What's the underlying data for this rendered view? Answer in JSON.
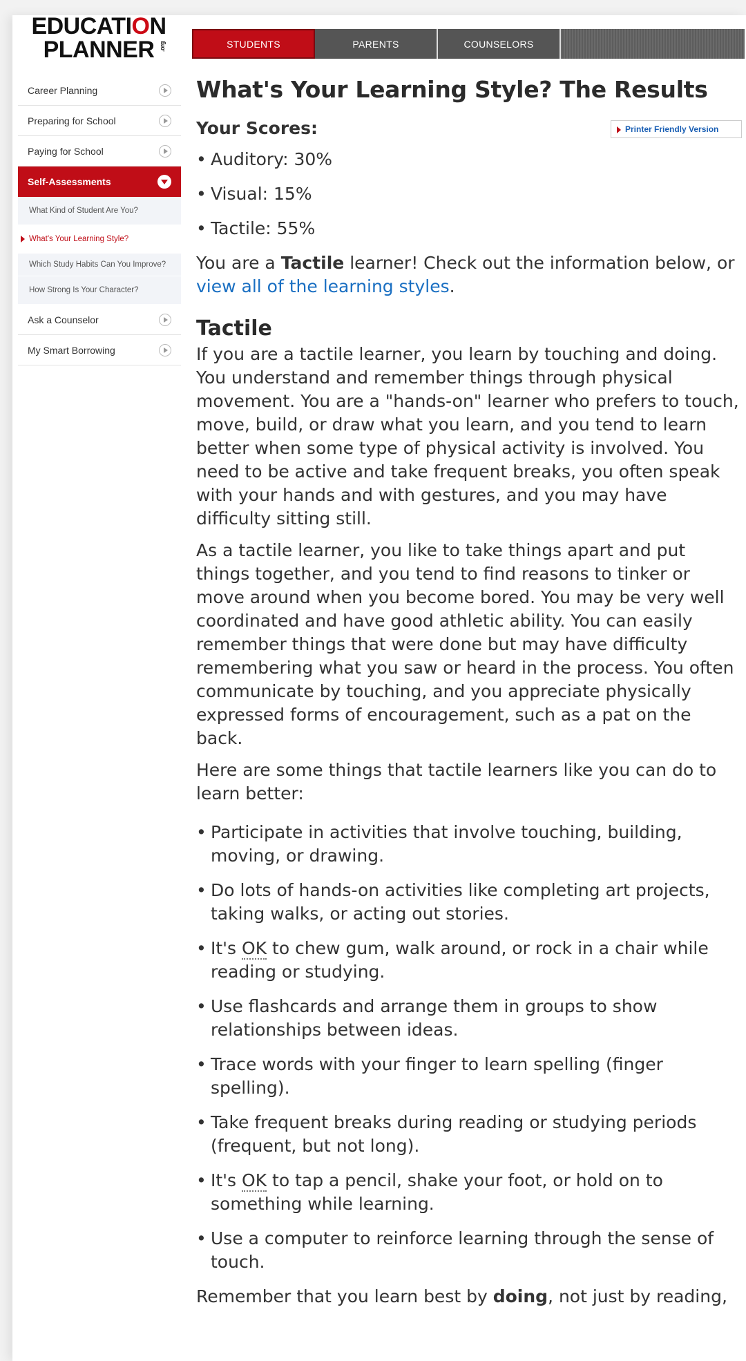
{
  "logo": {
    "line1_a": "EDUCATI",
    "line1_o": "O",
    "line1_b": "N",
    "line2": "PLANNER",
    "org": ".org"
  },
  "nav": {
    "tabs": [
      "STUDENTS",
      "PARENTS",
      "COUNSELORS"
    ]
  },
  "sidebar": {
    "items": [
      "Career Planning",
      "Preparing for School",
      "Paying for School"
    ],
    "active": "Self-Assessments",
    "sub_items": [
      "What Kind of Student Are You?",
      "What's Your Learning Style?",
      "Which Study Habits Can You Improve?",
      "How Strong Is Your Character?"
    ],
    "more_items": [
      "Ask a Counselor",
      "My Smart Borrowing"
    ]
  },
  "main": {
    "title": "What's Your Learning Style? The Results",
    "scores_heading": "Your Scores:",
    "printer_label": "Printer Friendly Version",
    "scores": [
      "Auditory: 30%",
      "Visual: 15%",
      "Tactile: 55%"
    ],
    "result": {
      "pre": "You are a ",
      "style": "Tactile",
      "mid": " learner! Check out the information below, or ",
      "link": "view all of the learning styles",
      "post": "."
    },
    "section_heading": "Tactile",
    "para1": "If you are a tactile learner, you learn by touching and doing. You understand and remember things through physical movement. You are a \"hands-on\" learner who prefers to touch, move, build, or draw what you learn, and you tend to learn better when some type of physical activity is involved. You need to be active and take frequent breaks, you often speak with your hands and with gestures, and you may have difficulty sitting still.",
    "para2": "As a tactile learner, you like to take things apart and put things together, and you tend to find reasons to tinker or move around when you become bored. You may be very well coordinated and have good athletic ability. You can easily remember things that were done but may have difficulty remembering what you saw or heard in the process. You often communicate by touching, and you appreciate physically expressed forms of encouragement, such as a pat on the back.",
    "tips_intro": "Here are some things that tactile learners like you can do to learn better:",
    "tips": [
      "Participate in activities that involve touching, building, moving, or drawing.",
      "Do lots of hands-on activities like completing art projects, taking walks, or acting out stories.",
      "It's OK to chew gum, walk around, or rock in a chair while reading or studying.",
      "Use flashcards and arrange them in groups to show relationships between ideas.",
      "Trace words with your finger to learn spelling (finger spelling).",
      "Take frequent breaks during reading or studying periods (frequent, but not long).",
      "It's OK to tap a pencil, shake your foot, or hold on to something while learning.",
      "Use a computer to reinforce learning through the sense of touch."
    ],
    "closing": {
      "pre": "Remember that you learn best by ",
      "bold": "doing",
      "post": ", not just by reading,"
    }
  }
}
